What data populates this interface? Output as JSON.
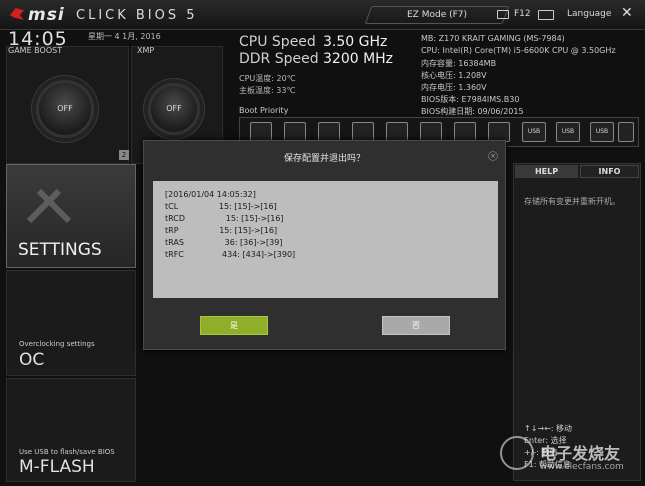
{
  "header": {
    "logo": "msi",
    "logo_sub": "CLICK BIOS 5",
    "ez_mode": "EZ Mode (F7)",
    "screenshot_key": "F12",
    "language": "Language"
  },
  "clock": {
    "time": "14:05",
    "date": "星期一  4 1月, 2016"
  },
  "game_boost": {
    "label": "GAME BOOST",
    "state": "OFF",
    "badge": "2"
  },
  "xmp": {
    "label": "XMP",
    "state": "OFF"
  },
  "cpu": {
    "cpu_speed_label": "CPU Speed",
    "cpu_speed": "3.50 GHz",
    "ddr_speed_label": "DDR Speed",
    "ddr_speed": "3200 MHz",
    "cpu_temp": "CPU温度: 20℃",
    "mb_temp": "主板温度: 33℃"
  },
  "sysinfo": [
    "MB: Z170 KRAIT GAMING (MS-7984)",
    "CPU: Intel(R) Core(TM) i5-6600K CPU @ 3.50GHz",
    "内存容量: 16384MB",
    "核心电压: 1.208V",
    "内存电压: 1.360V",
    "BIOS版本: E7984IMS.B30",
    "BIOS构建日期: 09/06/2015"
  ],
  "boot": {
    "label": "Boot Priority",
    "usb_label": "USB"
  },
  "menu": {
    "settings": "SETTINGS",
    "oc_sub": "Overclocking settings",
    "oc": "OC",
    "mflash_sub": "Use USB to flash/save BIOS",
    "mflash": "M-FLASH"
  },
  "help": {
    "help_tab": "HELP",
    "info_tab": "INFO",
    "text": "存储所有变更并重新开机。",
    "keys": [
      "↑↓→←: 移动",
      "Enter: 选择",
      "+/-: 数值",
      "F1: 帮助信息"
    ]
  },
  "dialog": {
    "title": "保存配置并退出吗？",
    "close": "×",
    "lines": [
      "[2016/01/04 14:05:32]",
      "tCL                15: [15]->[16]",
      "tRCD                15: [15]->[16]",
      "tRP                15: [15]->[16]",
      "tRAS                36: [36]->[39]",
      "tRFC               434: [434]->[390]"
    ],
    "yes": "是",
    "no": "否"
  },
  "watermark": {
    "text": "电子发烧友",
    "url": "www.elecfans.com"
  },
  "colors": {
    "accent_yes": "#8fae2a",
    "dialog_body": "#bdbdbd"
  }
}
